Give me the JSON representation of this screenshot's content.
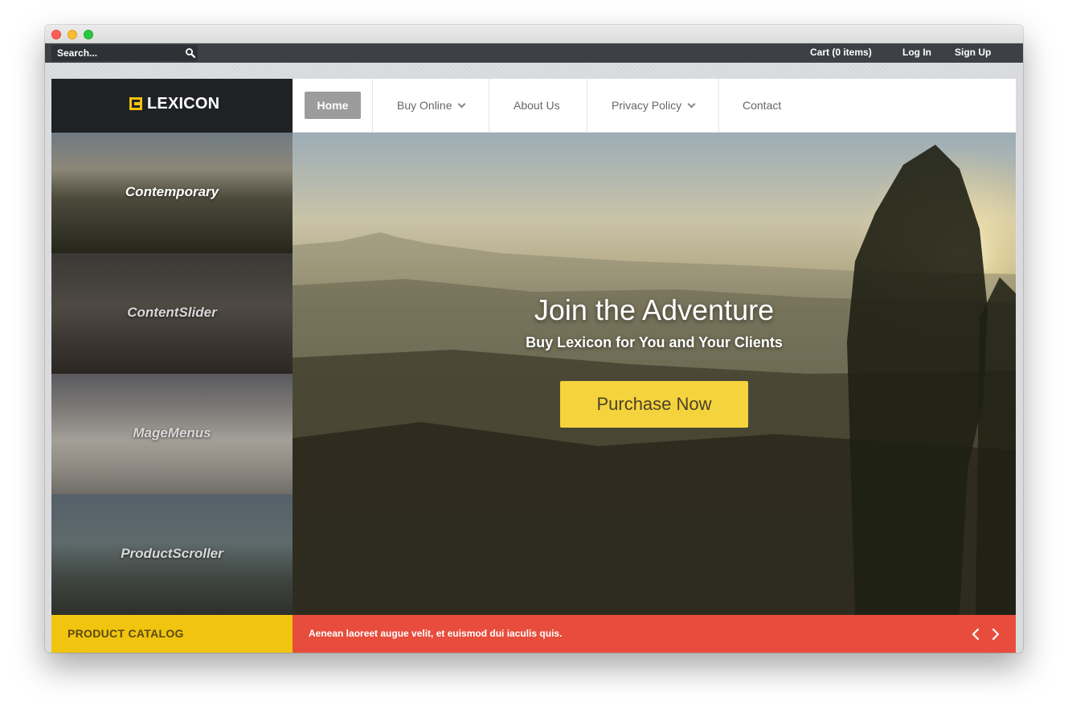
{
  "topbar": {
    "search_placeholder": "Search...",
    "cart": "Cart (0 items)",
    "login": "Log In",
    "signup": "Sign Up"
  },
  "brand": {
    "logo": "LEXICON",
    "accent": "#f1c40f"
  },
  "nav": {
    "home": "Home",
    "buy_online": "Buy Online",
    "about": "About Us",
    "privacy": "Privacy Policy",
    "contact": "Contact"
  },
  "side_panels": [
    "Contemporary",
    "ContentSlider",
    "MageMenus",
    "ProductScroller"
  ],
  "hero": {
    "title": "Join the Adventure",
    "subtitle": "Buy Lexicon for You and Your Clients",
    "cta": "Purchase Now",
    "cta_color": "#f5d33d"
  },
  "footer": {
    "catalog": "PRODUCT CATALOG",
    "ticker": "Aenean laoreet augue velit, et euismod dui iaculis quis.",
    "ticker_color": "#e74c3c"
  },
  "icons": {
    "search": "search-icon",
    "logo": "logo-icon",
    "dropdown": "chevron-down-icon",
    "prev": "chevron-left-icon",
    "next": "chevron-right-icon"
  }
}
